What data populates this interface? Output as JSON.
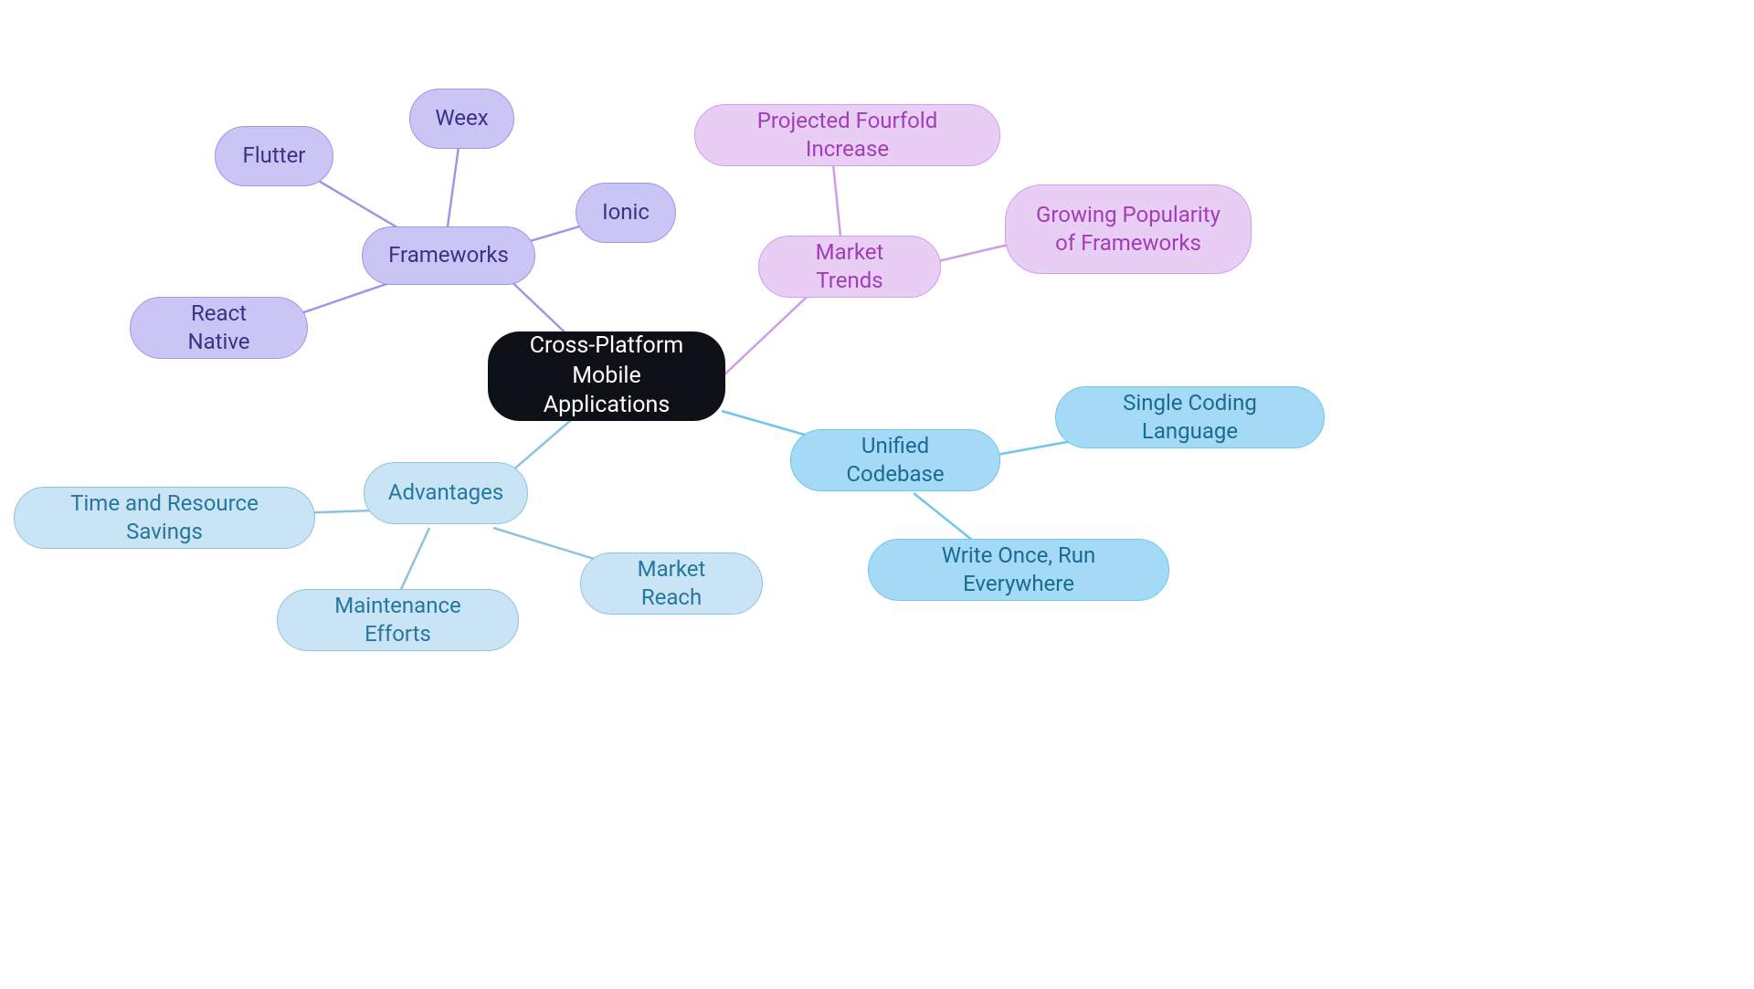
{
  "center": {
    "label": "Cross-Platform Mobile Applications"
  },
  "frameworks": {
    "label": "Frameworks",
    "children": {
      "flutter": "Flutter",
      "weex": "Weex",
      "ionic": "Ionic",
      "react_native": "React Native"
    }
  },
  "market_trends": {
    "label": "Market Trends",
    "children": {
      "fourfold": "Projected Fourfold Increase",
      "popularity": "Growing Popularity of Frameworks"
    }
  },
  "unified_codebase": {
    "label": "Unified Codebase",
    "children": {
      "single_lang": "Single Coding Language",
      "write_once": "Write Once, Run Everywhere"
    }
  },
  "advantages": {
    "label": "Advantages",
    "children": {
      "time_savings": "Time and Resource Savings",
      "maintenance": "Maintenance Efforts",
      "market_reach": "Market Reach"
    }
  }
}
